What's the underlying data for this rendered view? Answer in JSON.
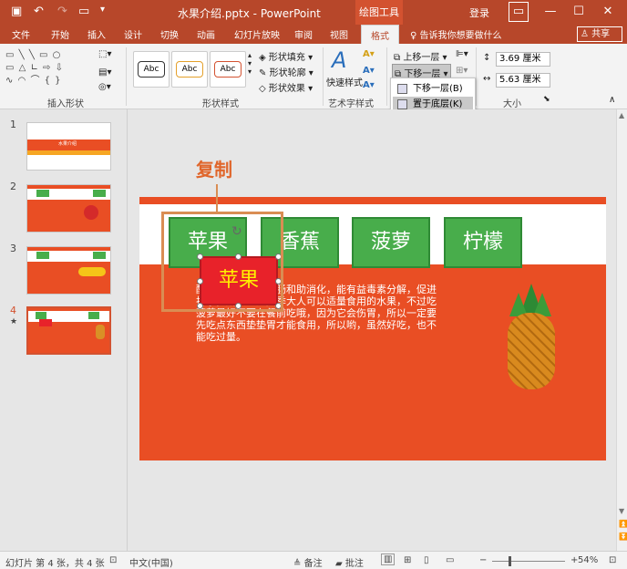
{
  "app": {
    "title": "水果介绍.pptx  -  PowerPoint",
    "context_tab": "绘图工具",
    "login": "登录"
  },
  "tabs": [
    "文件",
    "开始",
    "插入",
    "设计",
    "切换",
    "动画",
    "幻灯片放映",
    "审阅",
    "视图",
    "格式"
  ],
  "tell_me": "告诉我你想要做什么",
  "share": "共享",
  "ribbon": {
    "groups": {
      "insert_shapes": "插入形状",
      "shape_styles": "形状样式",
      "art_styles": "艺术字样式",
      "size": "大小"
    },
    "style_box_label": "Abc",
    "shape_fill": "形状填充",
    "shape_outline": "形状轮廓",
    "shape_effects": "形状效果",
    "quick_styles": "快速样式",
    "bring_forward": "上移一层",
    "send_backward": "下移一层",
    "height": "3.69 厘米",
    "width": "5.63 厘米"
  },
  "dropdown": {
    "item1": "下移一层(B)",
    "item2": "置于底层(K)"
  },
  "thumbs": {
    "nums": [
      "1",
      "2",
      "3",
      "4"
    ],
    "slide1_title": "水果介绍",
    "star": "★"
  },
  "slide": {
    "buttons": [
      "苹果",
      "香蕉",
      "菠萝",
      "柠檬"
    ],
    "copy_label": "苹果",
    "body_text": "酸性水果，可以整肠和助消化，能有益毒素分解，促进排水，所以它是夏季大人可以适量食用的水果，不过吃菠萝最好不要在餐前吃哦，因为它会伤胃，所以一定要先吃点东西垫垫胃才能食用，所以哟，虽然好吃，也不能吃过量。",
    "annotation": "复制"
  },
  "status": {
    "slide_info": "幻灯片 第 4 张，共 4 张",
    "language": "中文(中国)",
    "notes": "备注",
    "comments": "批注",
    "zoom": "54%"
  },
  "colors": {
    "brand": "#b7472a",
    "slide_orange": "#e94e24",
    "button_green": "#48ad4b",
    "copy_red": "#e8222a"
  }
}
